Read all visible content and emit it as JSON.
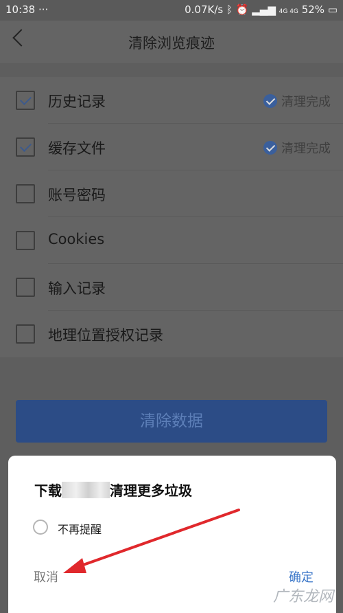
{
  "status_bar": {
    "time": "10:38",
    "dots": "···",
    "speed": "0.07K/s",
    "network": "4G 4G",
    "battery": "52%"
  },
  "header": {
    "title": "清除浏览痕迹"
  },
  "items": [
    {
      "label": "历史记录",
      "checked": true,
      "status": "清理完成"
    },
    {
      "label": "缓存文件",
      "checked": true,
      "status": "清理完成"
    },
    {
      "label": "账号密码",
      "checked": false
    },
    {
      "label": "Cookies",
      "checked": false
    },
    {
      "label": "输入记录",
      "checked": false
    },
    {
      "label": "地理位置授权记录",
      "checked": false
    }
  ],
  "clear_button": "清除数据",
  "dialog": {
    "message_prefix": "下载",
    "message_suffix": "清理更多垃圾",
    "remind": "不再提醒",
    "cancel": "取消",
    "ok": "确定"
  },
  "watermark": "广东龙网",
  "colors": {
    "accent": "#2c4c86",
    "confirm": "#3a76c8",
    "annotation_arrow": "#e0282c"
  }
}
